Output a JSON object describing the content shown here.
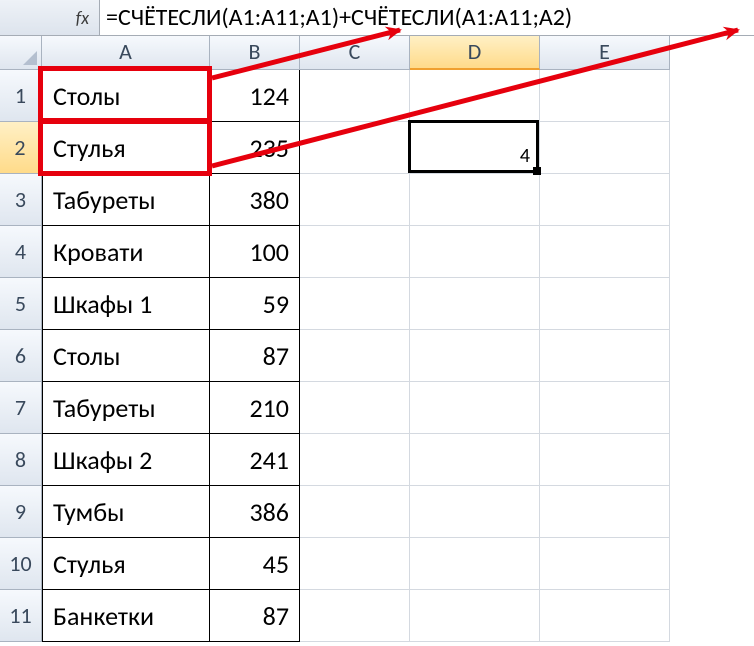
{
  "formula_label": "fx",
  "formula": "=СЧЁТЕСЛИ(A1:A11;A1)+СЧЁТЕСЛИ(A1:A11;A2)",
  "columns": [
    "A",
    "B",
    "C",
    "D",
    "E"
  ],
  "active_column": 3,
  "active_row": 1,
  "rows": [
    {
      "n": "1",
      "a": "Столы",
      "b": "124"
    },
    {
      "n": "2",
      "a": "Стулья",
      "b": "235"
    },
    {
      "n": "3",
      "a": "Табуреты",
      "b": "380"
    },
    {
      "n": "4",
      "a": "Кровати",
      "b": "100"
    },
    {
      "n": "5",
      "a": "Шкафы 1",
      "b": "59"
    },
    {
      "n": "6",
      "a": "Столы",
      "b": "87"
    },
    {
      "n": "7",
      "a": "Табуреты",
      "b": "210"
    },
    {
      "n": "8",
      "a": "Шкафы 2",
      "b": "241"
    },
    {
      "n": "9",
      "a": "Тумбы",
      "b": "386"
    },
    {
      "n": "10",
      "a": "Стулья",
      "b": "45"
    },
    {
      "n": "11",
      "a": "Банкетки",
      "b": "87"
    }
  ],
  "active_cell_value": "4"
}
